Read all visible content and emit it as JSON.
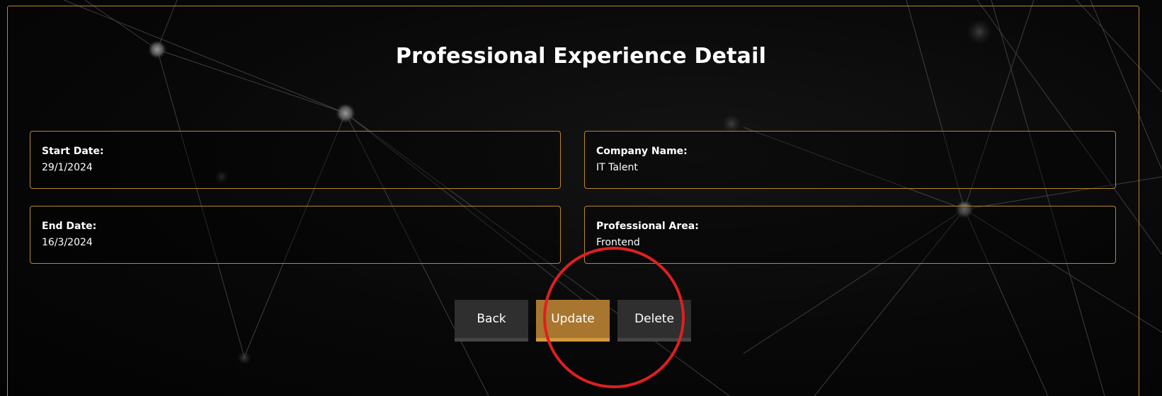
{
  "page": {
    "title": "Professional Experience Detail",
    "accent_color": "#b8862f",
    "annotation_color": "#e01f1f"
  },
  "fields": {
    "start_date": {
      "label": "Start Date:",
      "value": "29/1/2024"
    },
    "company_name": {
      "label": "Company Name:",
      "value": "IT Talent"
    },
    "end_date": {
      "label": "End Date:",
      "value": "16/3/2024"
    },
    "professional_area": {
      "label": "Professional Area:",
      "value": "Frontend"
    }
  },
  "actions": {
    "back_label": "Back",
    "update_label": "Update",
    "delete_label": "Delete"
  }
}
